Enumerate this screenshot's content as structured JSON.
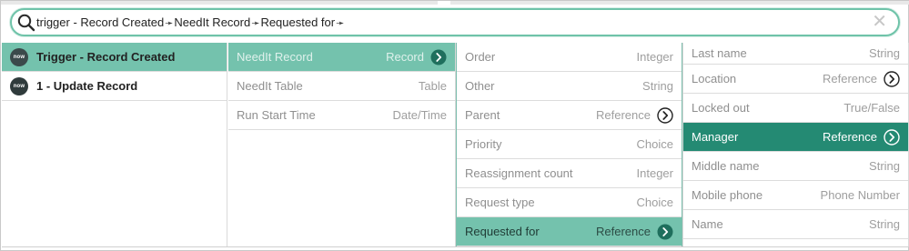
{
  "search": {
    "segments": [
      "trigger - Record Created",
      "NeedIt Record",
      "Requested for"
    ],
    "separator": "➛",
    "clear_glyph": "✕",
    "accent_color": "#6fc3a9"
  },
  "columns": {
    "triggers": [
      {
        "logo": "now",
        "label": "Trigger - Record Created"
      },
      {
        "logo": "now",
        "label": "1 - Update Record"
      }
    ],
    "record_fields": [
      {
        "label": "NeedIt Record",
        "type": "Record"
      },
      {
        "label": "NeedIt Table",
        "type": "Table"
      },
      {
        "label": "Run Start Time",
        "type": "Date/Time"
      }
    ],
    "needit_fields": [
      {
        "label": "Order",
        "type": "Integer"
      },
      {
        "label": "Other",
        "type": "String"
      },
      {
        "label": "Parent",
        "type": "Reference"
      },
      {
        "label": "Priority",
        "type": "Choice"
      },
      {
        "label": "Reassignment count",
        "type": "Integer"
      },
      {
        "label": "Request type",
        "type": "Choice"
      },
      {
        "label": "Requested for",
        "type": "Reference"
      }
    ],
    "user_fields": [
      {
        "label": "Last name",
        "type": "String"
      },
      {
        "label": "Location",
        "type": "Reference"
      },
      {
        "label": "Locked out",
        "type": "True/False"
      },
      {
        "label": "Manager",
        "type": "Reference"
      },
      {
        "label": "Middle name",
        "type": "String"
      },
      {
        "label": "Mobile phone",
        "type": "Phone Number"
      },
      {
        "label": "Name",
        "type": "String"
      }
    ]
  },
  "colors": {
    "selected_light": "#74c2ad",
    "selected_dark": "#248a73",
    "logo_bg": "#2f3b3c"
  }
}
